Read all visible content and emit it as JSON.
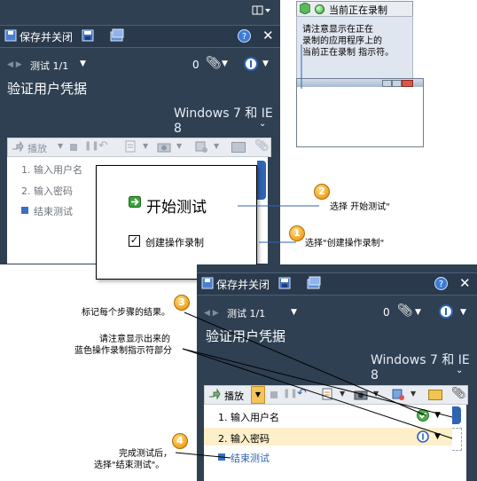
{
  "top_panel": {
    "save_close": "保存并关闭",
    "test_label": "测试 1/1",
    "attachment_count": "0",
    "title": "验证用户凭据",
    "config": "Windows 7 和 IE 8",
    "play_label": "播放",
    "steps": [
      "1. 输入用户名",
      "2. 输入密码"
    ],
    "end_test": "结束测试"
  },
  "popup": {
    "start_test": "开始测试",
    "create_recording": "创建操作录制"
  },
  "recorder_window": {
    "status": "当前正在录制",
    "note_lines": [
      "请注意显示在正在",
      "录制的应用程序上的",
      "当前正在录制 指示符。"
    ]
  },
  "bottom_panel": {
    "save_close": "保存并关闭",
    "test_label": "测试 1/1",
    "attachment_count": "0",
    "title": "验证用户凭据",
    "config": "Windows 7 和 IE 8",
    "play_label": "播放",
    "steps": [
      "1. 输入用户名",
      "2. 输入密码"
    ],
    "end_test": "结束测试"
  },
  "callouts": {
    "c1": {
      "num": "1",
      "text": "选择\"创建操作录制\""
    },
    "c2": {
      "num": "2",
      "text": "选择 开始测试\""
    },
    "c3": {
      "num": "3",
      "text": "标记每个步骤的结果。"
    },
    "note_blue": [
      "请注意显示出来的",
      "蓝色操作录制指示符部分"
    ],
    "c4": {
      "num": "4",
      "lines": [
        "完成测试后，",
        "选择\"结束测试\"。"
      ]
    }
  }
}
